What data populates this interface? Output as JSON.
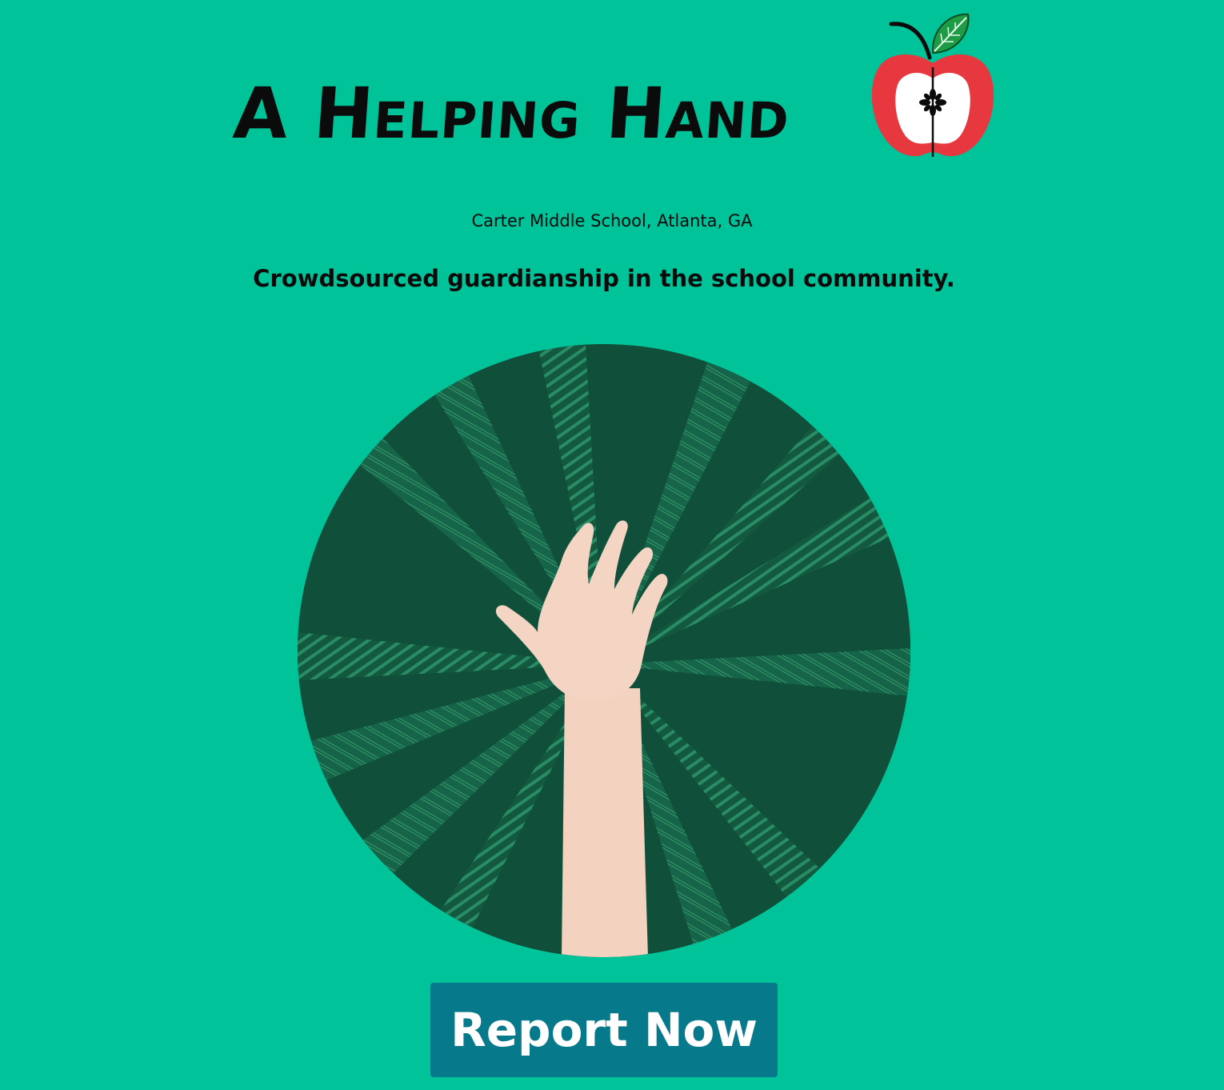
{
  "header": {
    "title": "A Helping Hand",
    "logo_icon": "apple-icon"
  },
  "school": "Carter Middle School, Atlanta, GA",
  "tagline": "Crowdsourced guardianship in the school community.",
  "hero_image": {
    "subject": "raised-hand-among-ferns",
    "icon": "hand-icon"
  },
  "cta": {
    "label": "Report Now"
  },
  "colors": {
    "background": "#00c39a",
    "button": "#06798a",
    "apple": "#e8383f",
    "leaf": "#1e9b45"
  }
}
